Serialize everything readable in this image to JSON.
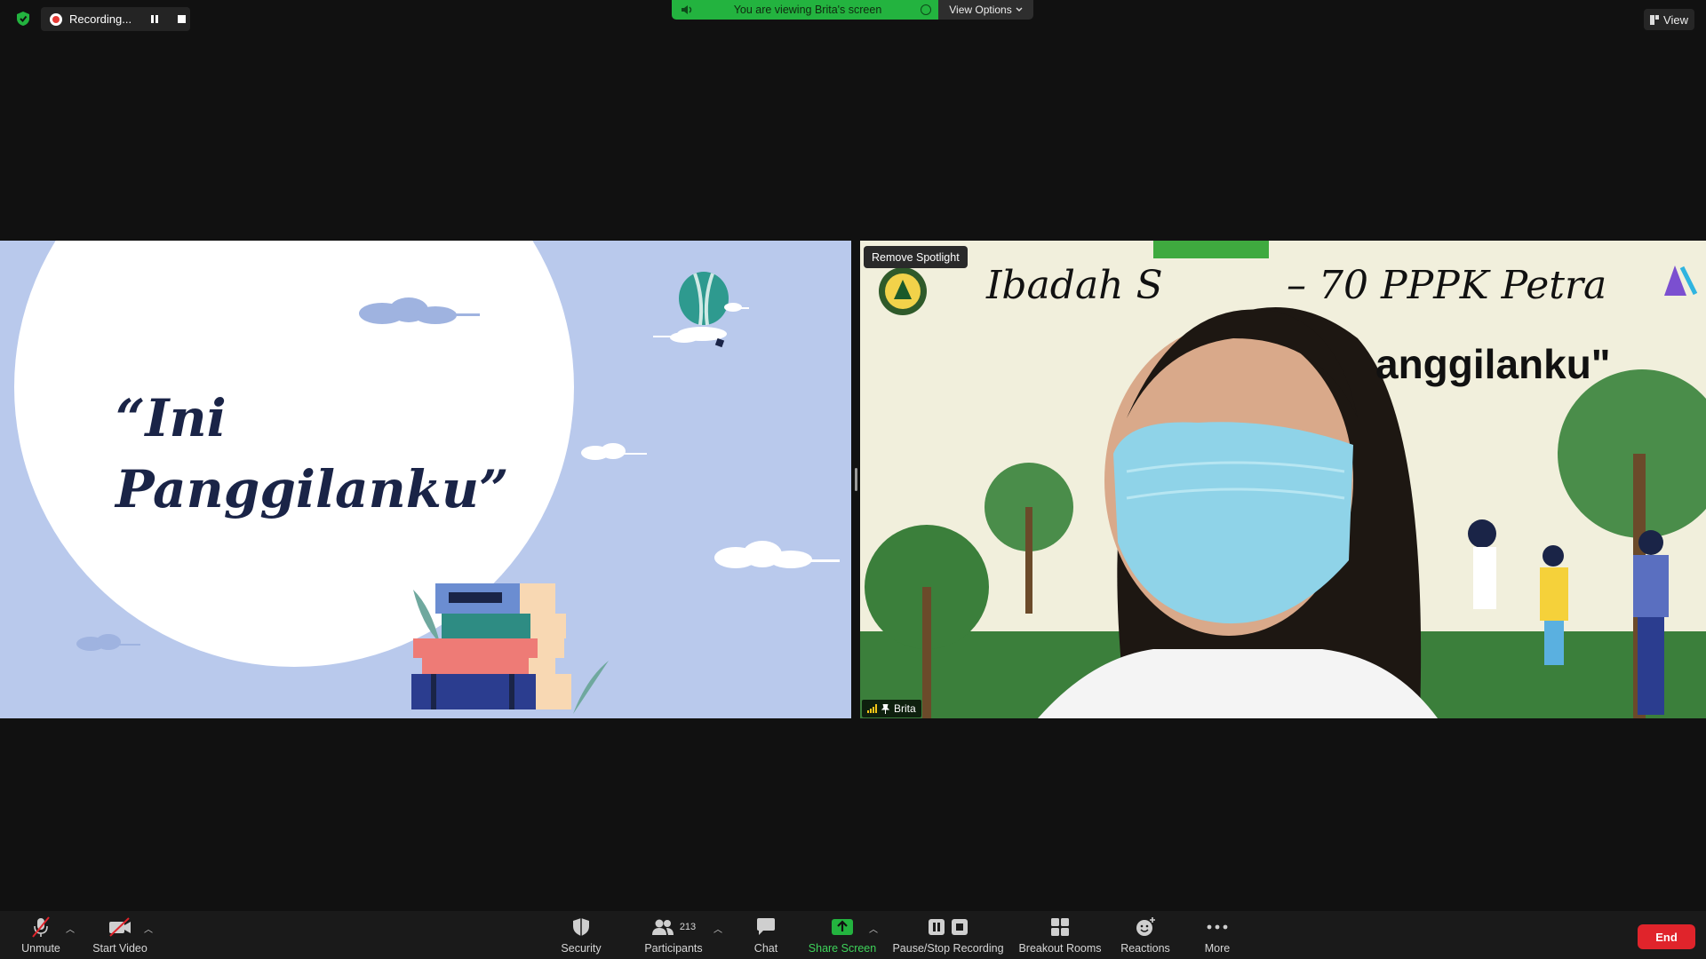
{
  "top_bar": {
    "recording_label": "Recording...",
    "viewing_label": "You are viewing Brita's screen",
    "view_options_label": "View Options",
    "view_label": "View"
  },
  "shared_slide": {
    "title_line1": "“Ini",
    "title_line2": "Panggilanku”"
  },
  "video": {
    "remove_spotlight_label": "Remove Spotlight",
    "participant_name": "Brita",
    "banner_title": "Ibadah S",
    "banner_title_right": "– 70 PPPK Petra",
    "banner_subtitle": "anggilanku\""
  },
  "toolbar": {
    "unmute_label": "Unmute",
    "start_video_label": "Start Video",
    "security_label": "Security",
    "participants_label": "Participants",
    "participants_count": "213",
    "chat_label": "Chat",
    "share_screen_label": "Share Screen",
    "pause_stop_label": "Pause/Stop Recording",
    "breakout_label": "Breakout Rooms",
    "reactions_label": "Reactions",
    "more_label": "More",
    "end_label": "End"
  },
  "colors": {
    "share_green": "#23b33f",
    "end_red": "#e0242b",
    "slide_bg": "#b9c9ec",
    "slide_text": "#1a2447"
  }
}
